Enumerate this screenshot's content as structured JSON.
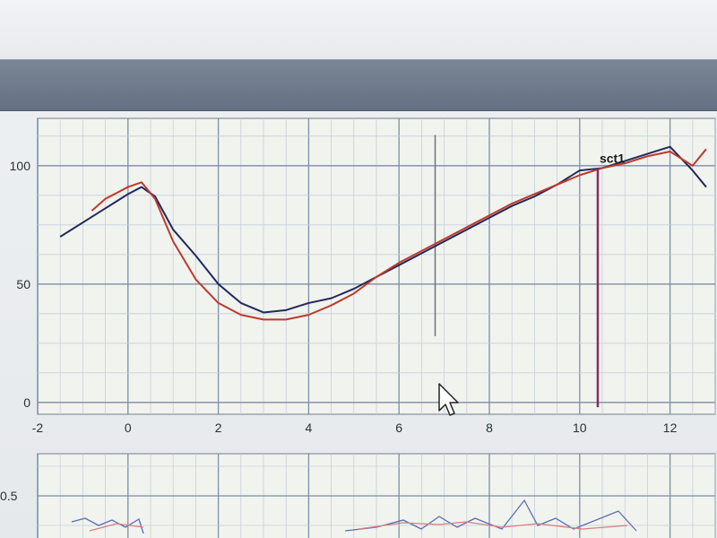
{
  "chart_data": [
    {
      "type": "line",
      "xlim": [
        -2,
        13
      ],
      "ylim": [
        -5,
        120
      ],
      "x_ticks": [
        "-2",
        "0",
        "2",
        "4",
        "6",
        "8",
        "10",
        "12"
      ],
      "y_ticks": [
        "0",
        "50",
        "100"
      ],
      "grid": true,
      "series": [
        {
          "color": "#1f2a5c",
          "x": [
            -1.5,
            -1.0,
            -0.5,
            0.0,
            0.3,
            0.6,
            1.0,
            1.5,
            2.0,
            2.5,
            3.0,
            3.5,
            4.0,
            4.5,
            5.0,
            5.5,
            6.0,
            6.5,
            7.0,
            7.5,
            8.0,
            8.5,
            9.0,
            9.5,
            10.0,
            10.5,
            11.0,
            11.5,
            12.0,
            12.5,
            12.8
          ],
          "y": [
            70,
            76,
            82,
            88,
            91,
            87,
            73,
            62,
            50,
            42,
            38,
            39,
            42,
            44,
            48,
            53,
            58,
            63,
            68,
            73,
            78,
            83,
            87,
            92,
            98,
            99,
            102,
            105,
            108,
            98,
            91
          ]
        },
        {
          "color": "#c0392b",
          "x": [
            -0.8,
            -0.5,
            0.0,
            0.3,
            0.6,
            1.0,
            1.5,
            2.0,
            2.5,
            3.0,
            3.5,
            4.0,
            4.5,
            5.0,
            5.5,
            6.0,
            6.5,
            7.0,
            7.5,
            8.0,
            8.5,
            9.0,
            9.5,
            10.0,
            10.5,
            11.0,
            11.5,
            12.0,
            12.5,
            12.8
          ],
          "y": [
            81,
            86,
            91,
            93,
            86,
            68,
            52,
            42,
            37,
            35,
            35,
            37,
            41,
            46,
            53,
            59,
            64,
            69,
            74,
            79,
            84,
            88,
            92,
            96,
            99,
            101,
            104,
            106,
            100,
            107
          ]
        }
      ],
      "cursor_x": 6.8,
      "marker": {
        "label": "sct1",
        "x": 10.4,
        "y": 99,
        "color": "#8e2a5a"
      }
    },
    {
      "type": "line",
      "y_ticks": [
        "0.5"
      ],
      "grid": true
    }
  ]
}
